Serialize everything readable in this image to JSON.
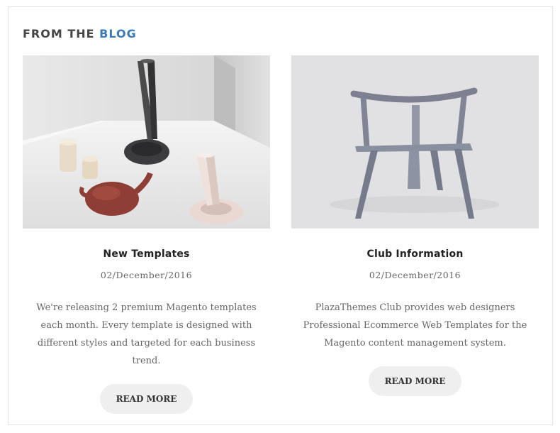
{
  "section": {
    "title_prefix": "FROM THE",
    "title_accent": "BLOG",
    "accent_color": "#3a7ab7"
  },
  "posts": [
    {
      "title": "New Templates",
      "date": "02/December/2016",
      "excerpt": "We're releasing 2 premium Magento templates each month. Every template is designed with different styles and targeted for each business trend.",
      "button_label": "READ MORE",
      "image_subject": "ceramic vases and teapot"
    },
    {
      "title": "Club Information",
      "date": "02/December/2016",
      "excerpt": "PlazaThemes Club provides web designers Professional Ecommerce Web Templates for the Magento content management system.",
      "button_label": "READ MORE",
      "image_subject": "wooden chair"
    }
  ]
}
